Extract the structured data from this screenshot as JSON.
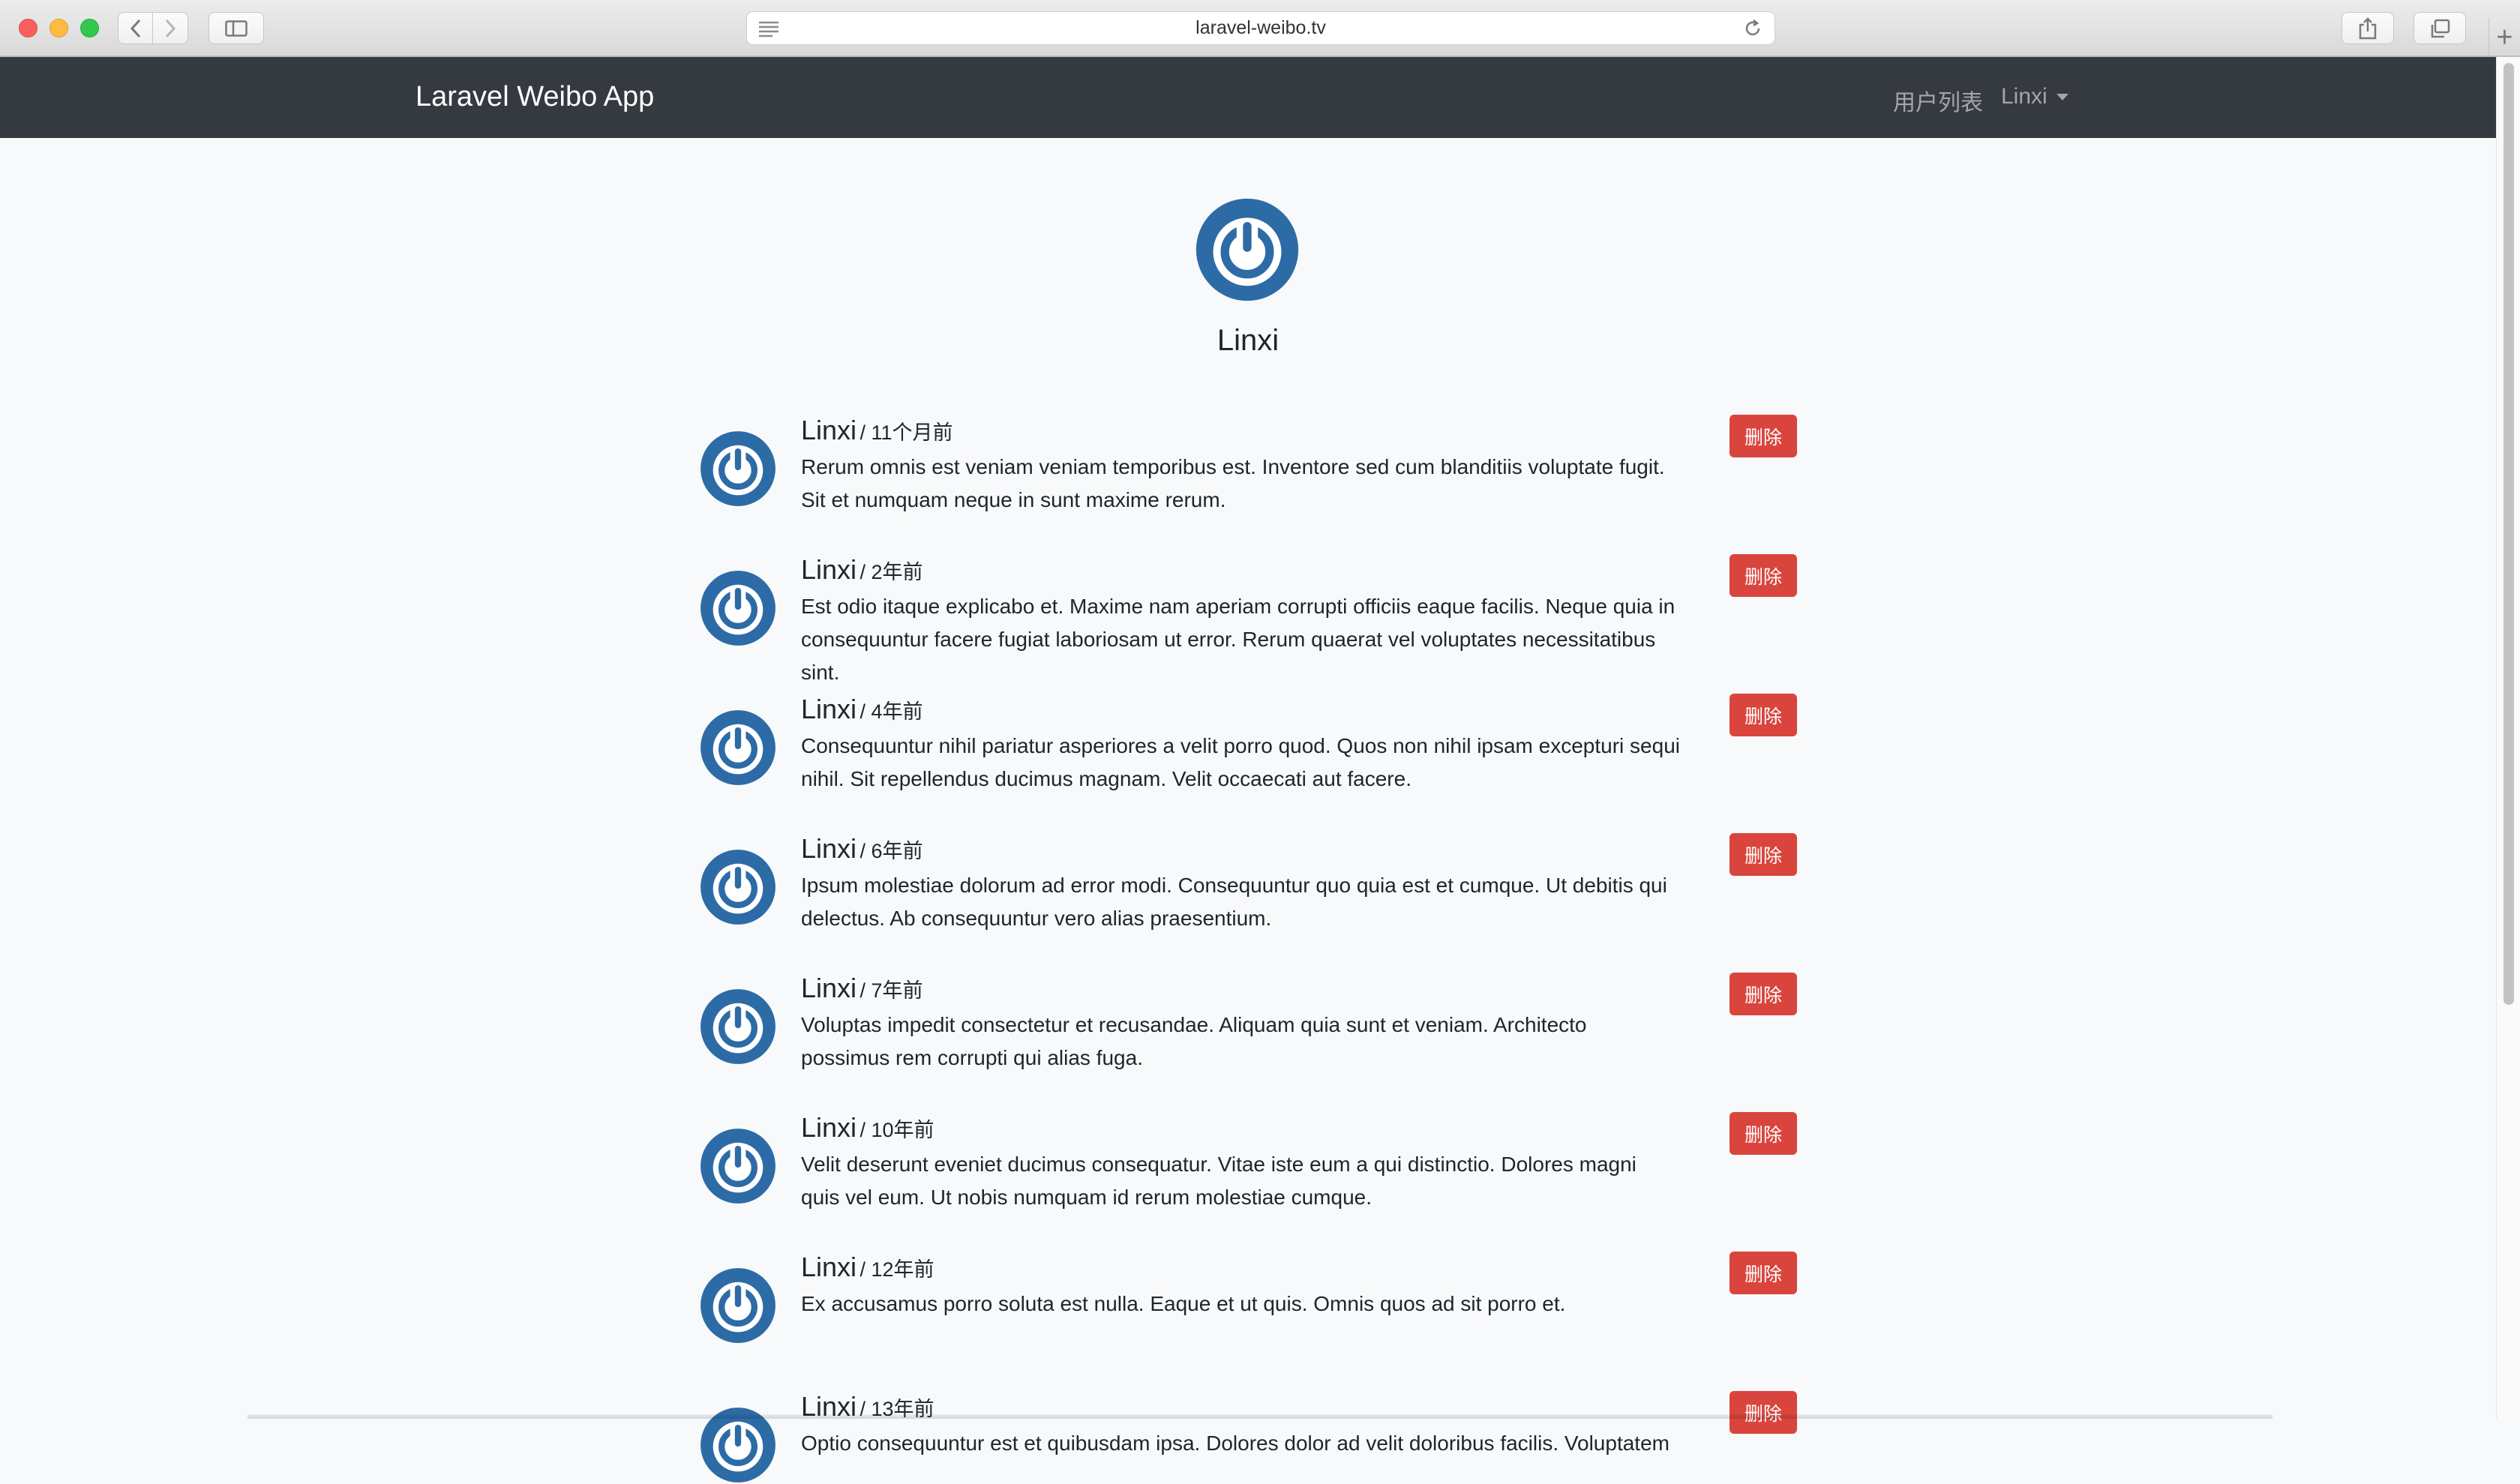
{
  "browser": {
    "url": "laravel-weibo.tv"
  },
  "navbar": {
    "brand": "Laravel Weibo App",
    "users_link": "用户列表",
    "current_user": "Linxi"
  },
  "profile": {
    "name": "Linxi"
  },
  "statuses": [
    {
      "name": "Linxi",
      "time": "/ 11个月前",
      "content": "Rerum omnis est veniam veniam temporibus est. Inventore sed cum blanditiis voluptate fugit. Sit et numquam neque in sunt maxime rerum.",
      "delete_label": "删除"
    },
    {
      "name": "Linxi",
      "time": "/ 2年前",
      "content": "Est odio itaque explicabo et. Maxime nam aperiam corrupti officiis eaque facilis. Neque quia in consequuntur facere fugiat laboriosam ut error. Rerum quaerat vel voluptates necessitatibus sint.",
      "delete_label": "删除"
    },
    {
      "name": "Linxi",
      "time": "/ 4年前",
      "content": "Consequuntur nihil pariatur asperiores a velit porro quod. Quos non nihil ipsam excepturi sequi nihil. Sit repellendus ducimus magnam. Velit occaecati aut facere.",
      "delete_label": "删除"
    },
    {
      "name": "Linxi",
      "time": "/ 6年前",
      "content": "Ipsum molestiae dolorum ad error modi. Consequuntur quo quia est et cumque. Ut debitis qui delectus. Ab consequuntur vero alias praesentium.",
      "delete_label": "删除"
    },
    {
      "name": "Linxi",
      "time": "/ 7年前",
      "content": "Voluptas impedit consectetur et recusandae. Aliquam quia sunt et veniam. Architecto possimus rem corrupti qui alias fuga.",
      "delete_label": "删除"
    },
    {
      "name": "Linxi",
      "time": "/ 10年前",
      "content": "Velit deserunt eveniet ducimus consequatur. Vitae iste eum a qui distinctio. Dolores magni quis vel eum. Ut nobis numquam id rerum molestiae cumque.",
      "delete_label": "删除"
    },
    {
      "name": "Linxi",
      "time": "/ 12年前",
      "content": "Ex accusamus porro soluta est nulla. Eaque et ut quis. Omnis quos ad sit porro et.",
      "delete_label": "删除"
    },
    {
      "name": "Linxi",
      "time": "/ 13年前",
      "content": "Optio consequuntur est et quibusdam ipsa. Dolores dolor ad velit doloribus facilis. Voluptatem",
      "delete_label": "删除"
    }
  ],
  "colors": {
    "navbar_bg": "#343a40",
    "delete_button": "#d9453d",
    "avatar_blue": "#2d6ba6"
  }
}
